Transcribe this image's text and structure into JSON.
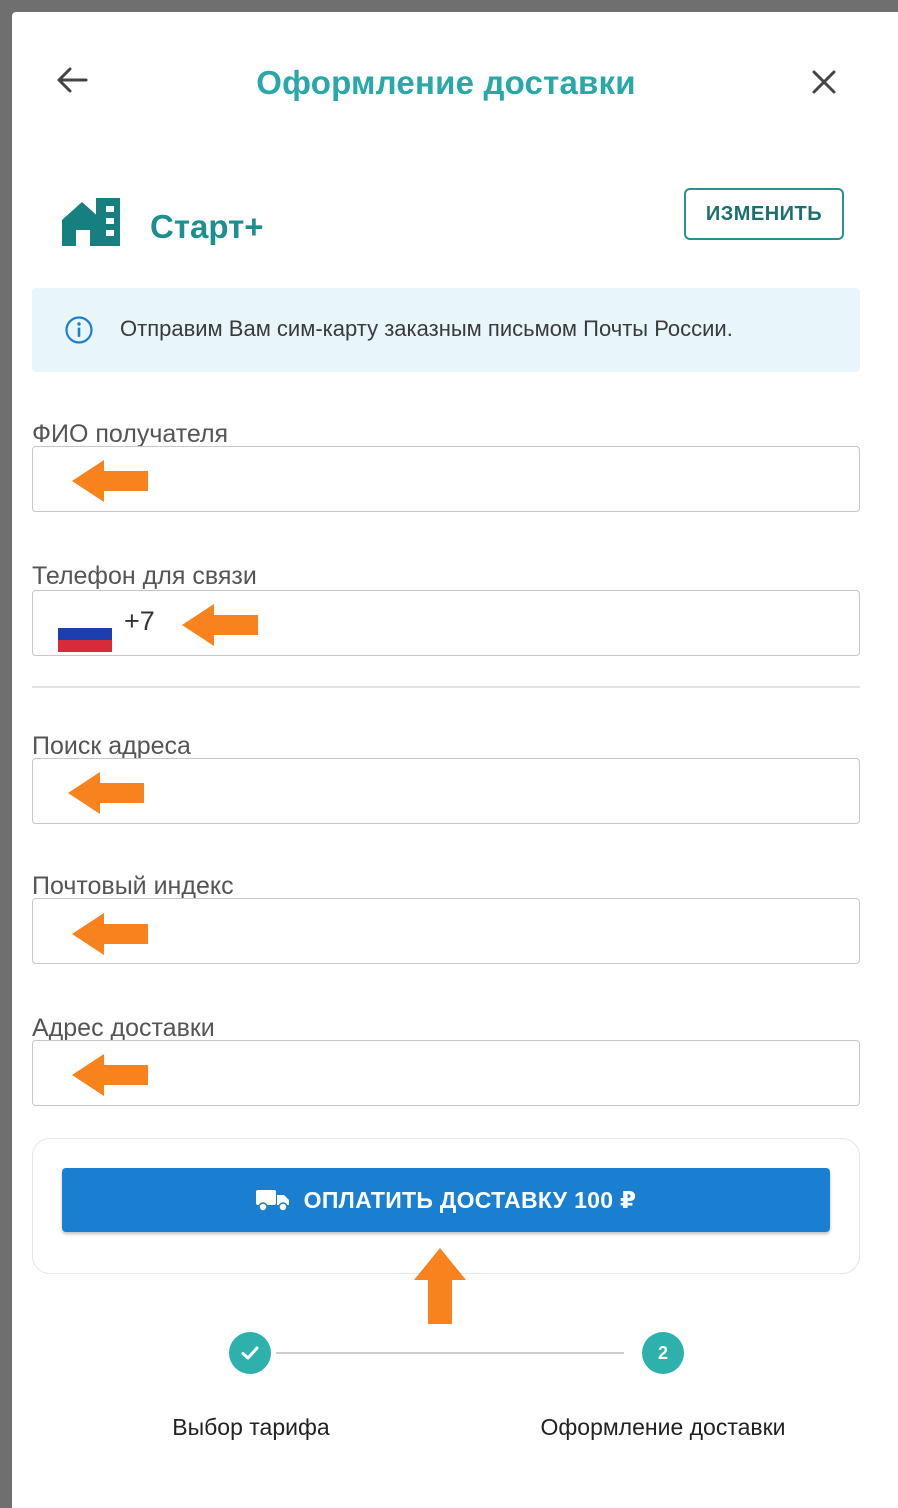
{
  "header": {
    "title": "Оформление доставки",
    "back_icon": "arrow-left-icon",
    "close_icon": "close-icon"
  },
  "tariff": {
    "name": "Старт+",
    "icon": "house-icon",
    "change_label": "ИЗМЕНИТЬ"
  },
  "info": {
    "icon": "info-icon",
    "text": "Отправим Вам сим-карту заказным письмом Почты России."
  },
  "form": {
    "full_name": {
      "label": "ФИО получателя",
      "value": ""
    },
    "phone": {
      "label": "Телефон для связи",
      "prefix": "+7",
      "flag": "russia-flag-icon",
      "value": ""
    },
    "address_search": {
      "label": "Поиск адреса",
      "value": ""
    },
    "postal_code": {
      "label": "Почтовый индекс",
      "value": ""
    },
    "delivery_address": {
      "label": "Адрес доставки",
      "value": ""
    }
  },
  "pay_button": {
    "label": "ОПЛАТИТЬ ДОСТАВКУ 100 ₽",
    "icon": "truck-icon"
  },
  "stepper": {
    "steps": [
      {
        "label": "Выбор тарифа",
        "state": "completed",
        "icon": "check-icon"
      },
      {
        "label": "Оформление доставки",
        "state": "current",
        "number": "2"
      }
    ]
  },
  "colors": {
    "accent": "#2aa8a8",
    "primary_button": "#1a7fd1",
    "info_background": "#e8f5fb",
    "annotation_arrow": "#f7821e",
    "step_circle": "#2eb1ad"
  }
}
